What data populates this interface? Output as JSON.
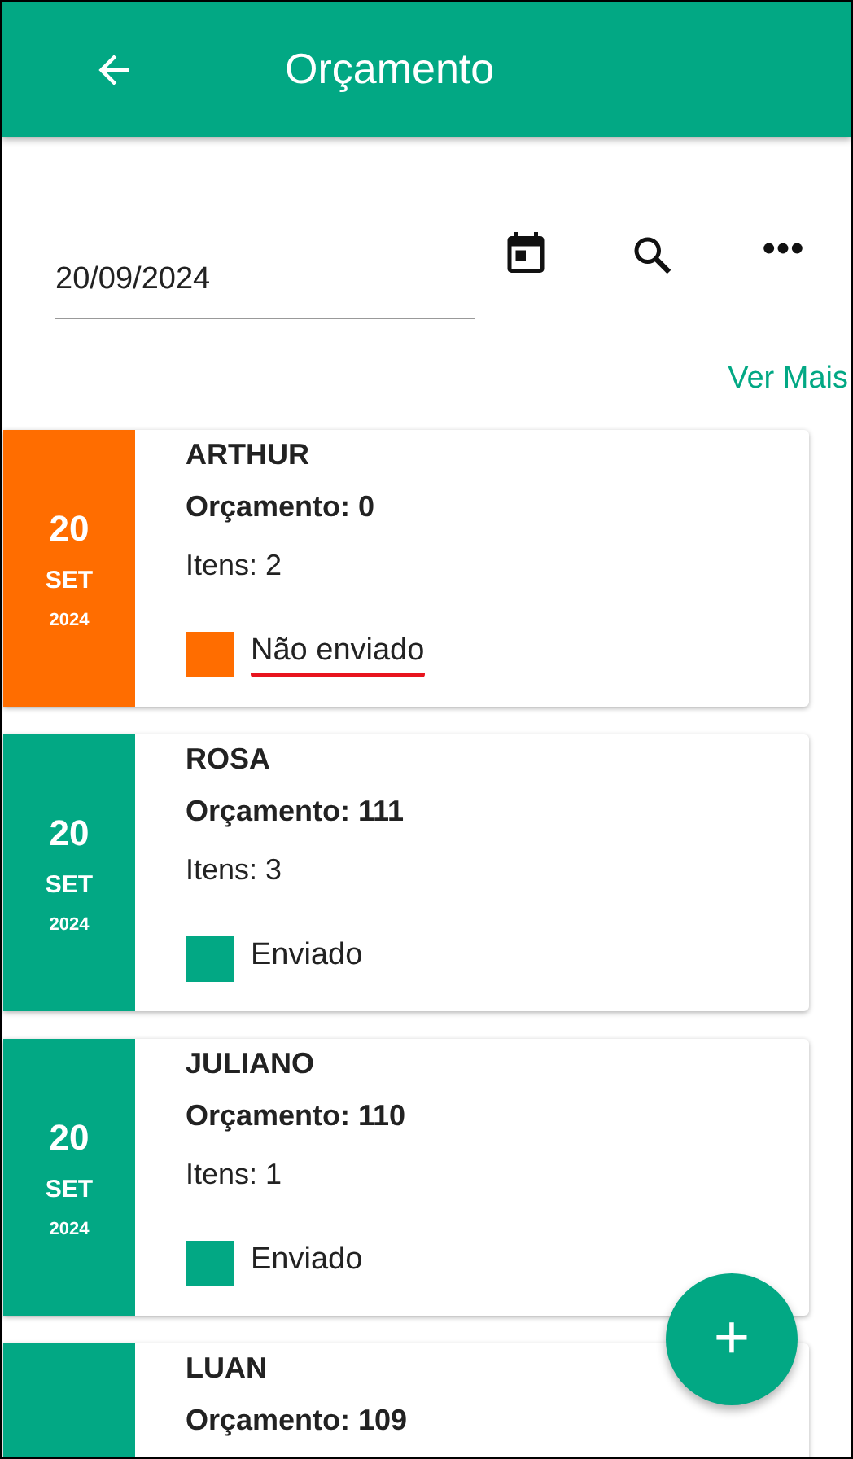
{
  "app_bar": {
    "title": "Orçamento"
  },
  "filter": {
    "date_value": "20/09/2024"
  },
  "see_more": "Ver Mais",
  "budgets": [
    {
      "day": "20",
      "month": "SET",
      "year": "2024",
      "client": "ARTHUR",
      "budget": "Orçamento: 0",
      "items": "Itens: 2",
      "status": {
        "label": "Não enviado",
        "color": "#ff6d00",
        "flagged": true
      }
    },
    {
      "day": "20",
      "month": "SET",
      "year": "2024",
      "client": "ROSA",
      "budget": "Orçamento: 111",
      "items": "Itens: 3",
      "status": {
        "label": "Enviado",
        "color": "#02a884",
        "flagged": false
      }
    },
    {
      "day": "20",
      "month": "SET",
      "year": "2024",
      "client": "JULIANO",
      "budget": "Orçamento: 110",
      "items": "Itens: 1",
      "status": {
        "label": "Enviado",
        "color": "#02a884",
        "flagged": false
      }
    },
    {
      "client": "LUAN",
      "budget": "Orçamento: 109",
      "status": {
        "color": "#02a884"
      }
    }
  ],
  "fab": "+"
}
